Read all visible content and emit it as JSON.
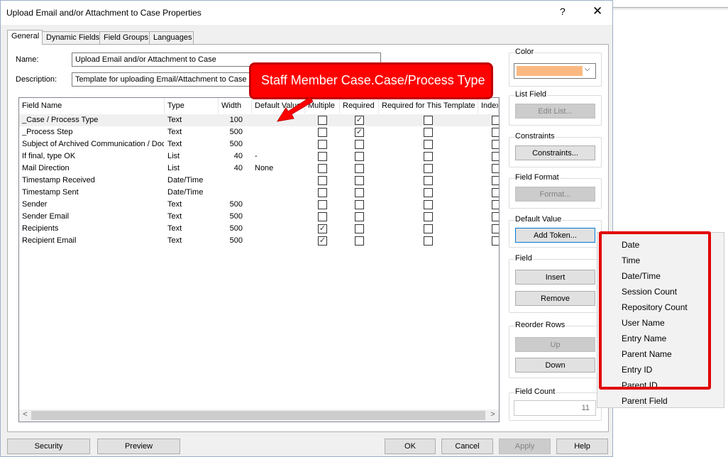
{
  "window": {
    "title": "Upload Email and/or Attachment to Case Properties",
    "help_glyph": "?",
    "close_glyph": "✕"
  },
  "tabs": [
    "General",
    "Dynamic Fields",
    "Field Groups",
    "Languages"
  ],
  "form": {
    "name_label": "Name:",
    "name_value": "Upload Email and/or Attachment to Case",
    "description_label": "Description:",
    "description_value": "Template for uploading Email/Attachment to Case"
  },
  "grid": {
    "columns": [
      "Field Name",
      "Type",
      "Width",
      "Default Value",
      "Multiple",
      "Required",
      "Required for This Template",
      "Index"
    ],
    "rows": [
      {
        "name": "_Case / Process Type",
        "type": "Text",
        "width": "100",
        "default": "",
        "multiple": false,
        "required": true,
        "req_template": false
      },
      {
        "name": "_Process Step",
        "type": "Text",
        "width": "500",
        "default": "",
        "multiple": false,
        "required": true,
        "req_template": false
      },
      {
        "name": "Subject of Archived Communication / Doc",
        "type": "Text",
        "width": "500",
        "default": "",
        "multiple": false,
        "required": false,
        "req_template": false
      },
      {
        "name": "If final, type OK",
        "type": "List",
        "width": "40",
        "default": "-",
        "multiple": false,
        "required": false,
        "req_template": false
      },
      {
        "name": "Mail Direction",
        "type": "List",
        "width": "40",
        "default": "None",
        "multiple": false,
        "required": false,
        "req_template": false
      },
      {
        "name": "Timestamp Received",
        "type": "Date/Time",
        "width": "",
        "default": "",
        "multiple": false,
        "required": false,
        "req_template": false
      },
      {
        "name": "Timestamp Sent",
        "type": "Date/Time",
        "width": "",
        "default": "",
        "multiple": false,
        "required": false,
        "req_template": false
      },
      {
        "name": "Sender",
        "type": "Text",
        "width": "500",
        "default": "",
        "multiple": false,
        "required": false,
        "req_template": false
      },
      {
        "name": "Sender Email",
        "type": "Text",
        "width": "500",
        "default": "",
        "multiple": false,
        "required": false,
        "req_template": false
      },
      {
        "name": "Recipients",
        "type": "Text",
        "width": "500",
        "default": "",
        "multiple": true,
        "required": false,
        "req_template": false
      },
      {
        "name": "Recipient Email",
        "type": "Text",
        "width": "500",
        "default": "",
        "multiple": true,
        "required": false,
        "req_template": false
      }
    ],
    "scroll_left_glyph": "<",
    "scroll_right_glyph": ">"
  },
  "callout": {
    "text": "Staff Member Case.Case/Process Type",
    "color": "#ff0000"
  },
  "side": {
    "color_label": "Color",
    "color_value": "#fbb981",
    "list_field_label": "List Field",
    "edit_list": "Edit List...",
    "constraints_label": "Constraints",
    "constraints_btn": "Constraints...",
    "field_format_label": "Field Format",
    "format_btn": "Format...",
    "default_value_label": "Default Value",
    "add_token_btn": "Add Token...",
    "field_label": "Field",
    "insert_btn": "Insert",
    "remove_btn": "Remove",
    "reorder_label": "Reorder Rows",
    "up_btn": "Up",
    "down_btn": "Down",
    "field_count_label": "Field Count",
    "field_count_value": "11"
  },
  "token_menu": [
    "Date",
    "Time",
    "Date/Time",
    "Session Count",
    "Repository Count",
    "User Name",
    "Entry Name",
    "Parent Name",
    "Entry ID",
    "Parent ID",
    "Parent Field"
  ],
  "bottom": {
    "security": "Security",
    "preview": "Preview",
    "ok": "OK",
    "cancel": "Cancel",
    "apply": "Apply",
    "help": "Help"
  }
}
